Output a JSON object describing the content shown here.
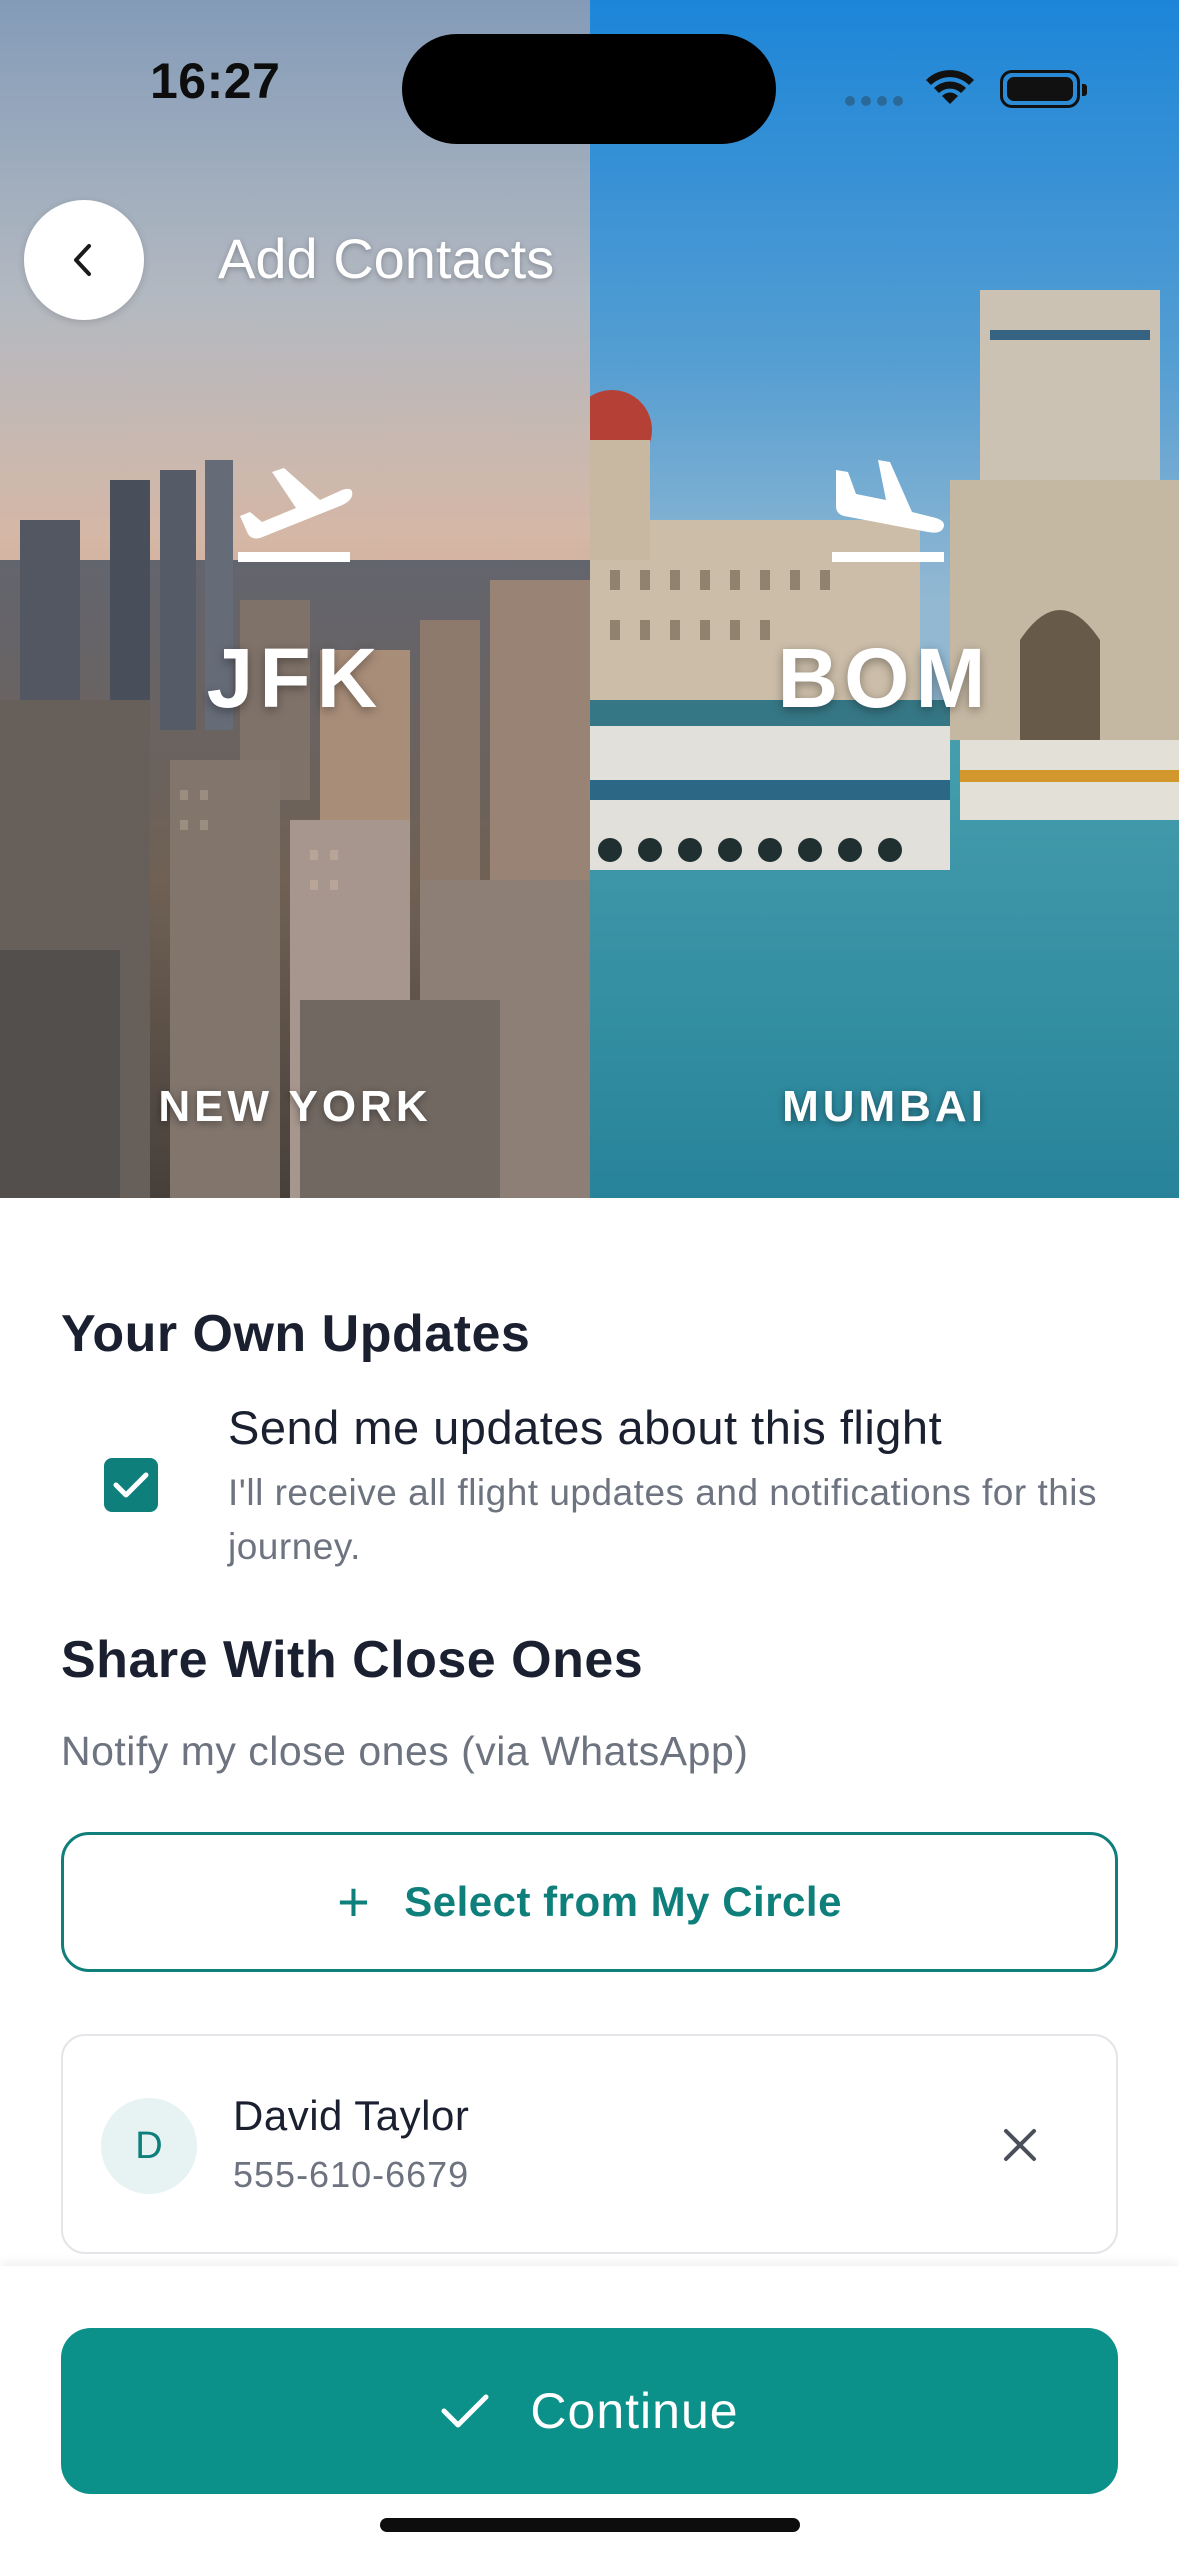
{
  "status_bar": {
    "time": "16:27"
  },
  "header": {
    "title": "Add Contacts"
  },
  "route": {
    "origin": {
      "code": "JFK",
      "city": "NEW YORK"
    },
    "destination": {
      "code": "BOM",
      "city": "MUMBAI"
    }
  },
  "own_updates": {
    "title": "Your Own Updates",
    "checked": true,
    "option_label": "Send me updates about this flight",
    "option_description": "I'll receive all flight updates and notifications for this journey."
  },
  "share": {
    "title": "Share With Close Ones",
    "subtitle": "Notify my close ones (via WhatsApp)",
    "select_button": "Select from My Circle"
  },
  "contacts": [
    {
      "initial": "D",
      "name": "David Taylor",
      "phone": "555-610-6679"
    }
  ],
  "footer": {
    "continue_label": "Continue"
  },
  "colors": {
    "accent": "#0f7f7b",
    "button": "#0b9189"
  },
  "icons": [
    "back-icon",
    "plane-departure-icon",
    "plane-arrival-icon",
    "check-icon",
    "plus-icon",
    "close-icon"
  ]
}
